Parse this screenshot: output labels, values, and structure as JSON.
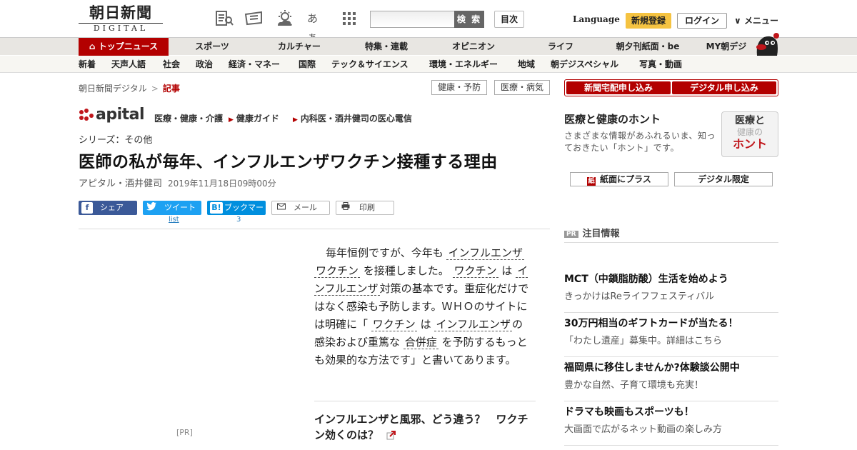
{
  "header": {
    "logo_top": "朝日新聞",
    "logo_bottom": "DIGITAL",
    "icon_text_size": "あぁ",
    "search_button": "検 索",
    "toc_button": "目次",
    "language": "Language",
    "signup": "新規登録",
    "login": "ログイン",
    "menu": "メニュー"
  },
  "nav_main": {
    "items": [
      "トップニュース",
      "スポーツ",
      "カルチャー",
      "特集・連載",
      "オピニオン",
      "ライフ",
      "朝夕刊紙面・be",
      "MY朝デジ"
    ]
  },
  "nav_sub": {
    "items": [
      "新着",
      "天声人語",
      "社会",
      "政治",
      "経済・マネー",
      "国際",
      "テック＆サイエンス",
      "環境・エネルギー",
      "地域",
      "朝デジスペシャル",
      "写真・動画"
    ]
  },
  "breadcrumb": {
    "root": "朝日新聞デジタル",
    "sep": ">",
    "current": "記事"
  },
  "tags": [
    "健康・予防",
    "医療・病気"
  ],
  "apital": {
    "logo": "apital",
    "category": "医療・健康・介護",
    "links": [
      "健康ガイド",
      "内科医・酒井健司の医心電信"
    ]
  },
  "article": {
    "series": "シリーズ：その他",
    "title": "医師の私が毎年、インフルエンザワクチン接種する理由",
    "author": "アピタル・酒井健司",
    "date": "2019年11月18日09時00分",
    "body": {
      "p1": "毎年恒例ですが、今年も",
      "kw1": "インフルエンザ",
      "kw2": "ワクチン",
      "p2": "を接種しました。",
      "kw3": "ワクチン",
      "p3": "は",
      "kw4": "インフルエンザ",
      "p4": "対策の基本です。重症化だけではなく感染も予防します。ＷＨＯのサイトには明確に「",
      "kw5": "ワクチン",
      "p5": "は",
      "kw6": "インフルエンザ",
      "p6": "の感染および重篤な",
      "kw7": "合併症",
      "p7": "を予防するもっとも効果的な方法です」と書いてあります。"
    },
    "related": "インフルエンザと風邪、どう違う？　ワクチン効くのは？"
  },
  "share": {
    "facebook": "シェア",
    "twitter": "ツイート",
    "twitter_count": "list",
    "hatena": "ブックマーク",
    "hatena_icon": "B!",
    "hatena_count": "3",
    "mail": "メール",
    "print": "印刷"
  },
  "pr_left": "[PR]",
  "sidebar": {
    "subscribe_paper": "新聞宅配申し込み",
    "subscribe_digital": "デジタル申し込み",
    "honto_title": "医療と健康のホント",
    "honto_desc": "さまざまな情報があふれるいま、知っておきたい「ホント」です。",
    "honto_badge_a": "医療と",
    "honto_badge_b": "健康の",
    "honto_badge_c": "ホント",
    "plus_paper": "紙面にプラス",
    "plus_digital": "デジタル限定",
    "pr_badge": "PR",
    "pr_heading": "注目情報",
    "pr_items": [
      {
        "title": "MCT（中鎖脂肪酸）生活を始めよう",
        "sub": "きっかけはReライフフェスティバル"
      },
      {
        "title": "30万円相当のギフトカードが当たる！",
        "sub": "「わたし遺産」募集中。詳細はこちら"
      },
      {
        "title": "福岡県に移住しませんか?体験談公開中",
        "sub": "豊かな自然、子育て環境も充実！"
      },
      {
        "title": "ドラマも映画もスポーツも！",
        "sub": "大画面で広がるネット動画の楽しみ方"
      }
    ]
  },
  "colors": {
    "brand_red": "#b30000",
    "signup_yellow": "#f5c341",
    "facebook": "#3b5998",
    "twitter": "#1da1f2",
    "hatena": "#008fde"
  }
}
